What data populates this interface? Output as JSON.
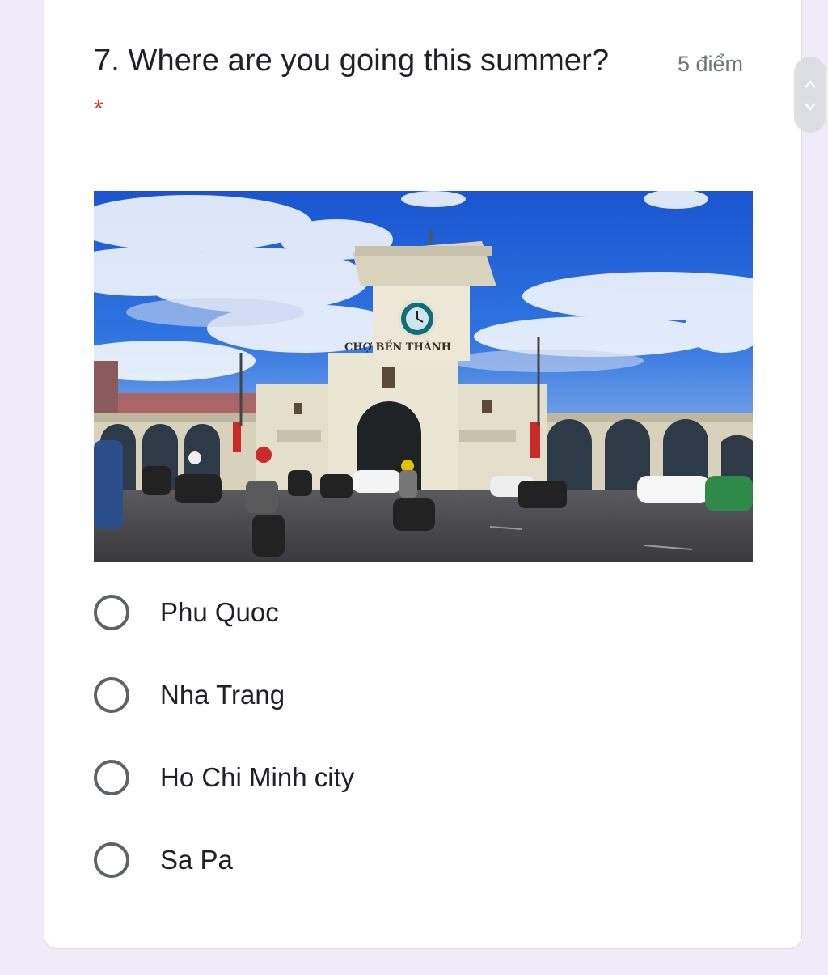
{
  "question": {
    "title": "7. Where are you going this summer?",
    "points": "5 điểm",
    "required_mark": "*"
  },
  "image": {
    "sign_text": "CHỢ BẾN THÀNH"
  },
  "options": [
    {
      "label": "Phu Quoc"
    },
    {
      "label": "Nha Trang"
    },
    {
      "label": "Ho Chi Minh city"
    },
    {
      "label": "Sa Pa"
    }
  ],
  "colors": {
    "page_background": "#f0ebf8",
    "card": "#ffffff",
    "required": "#d93025",
    "radio_border": "#5f6368",
    "sky": "#1f5fd6"
  }
}
